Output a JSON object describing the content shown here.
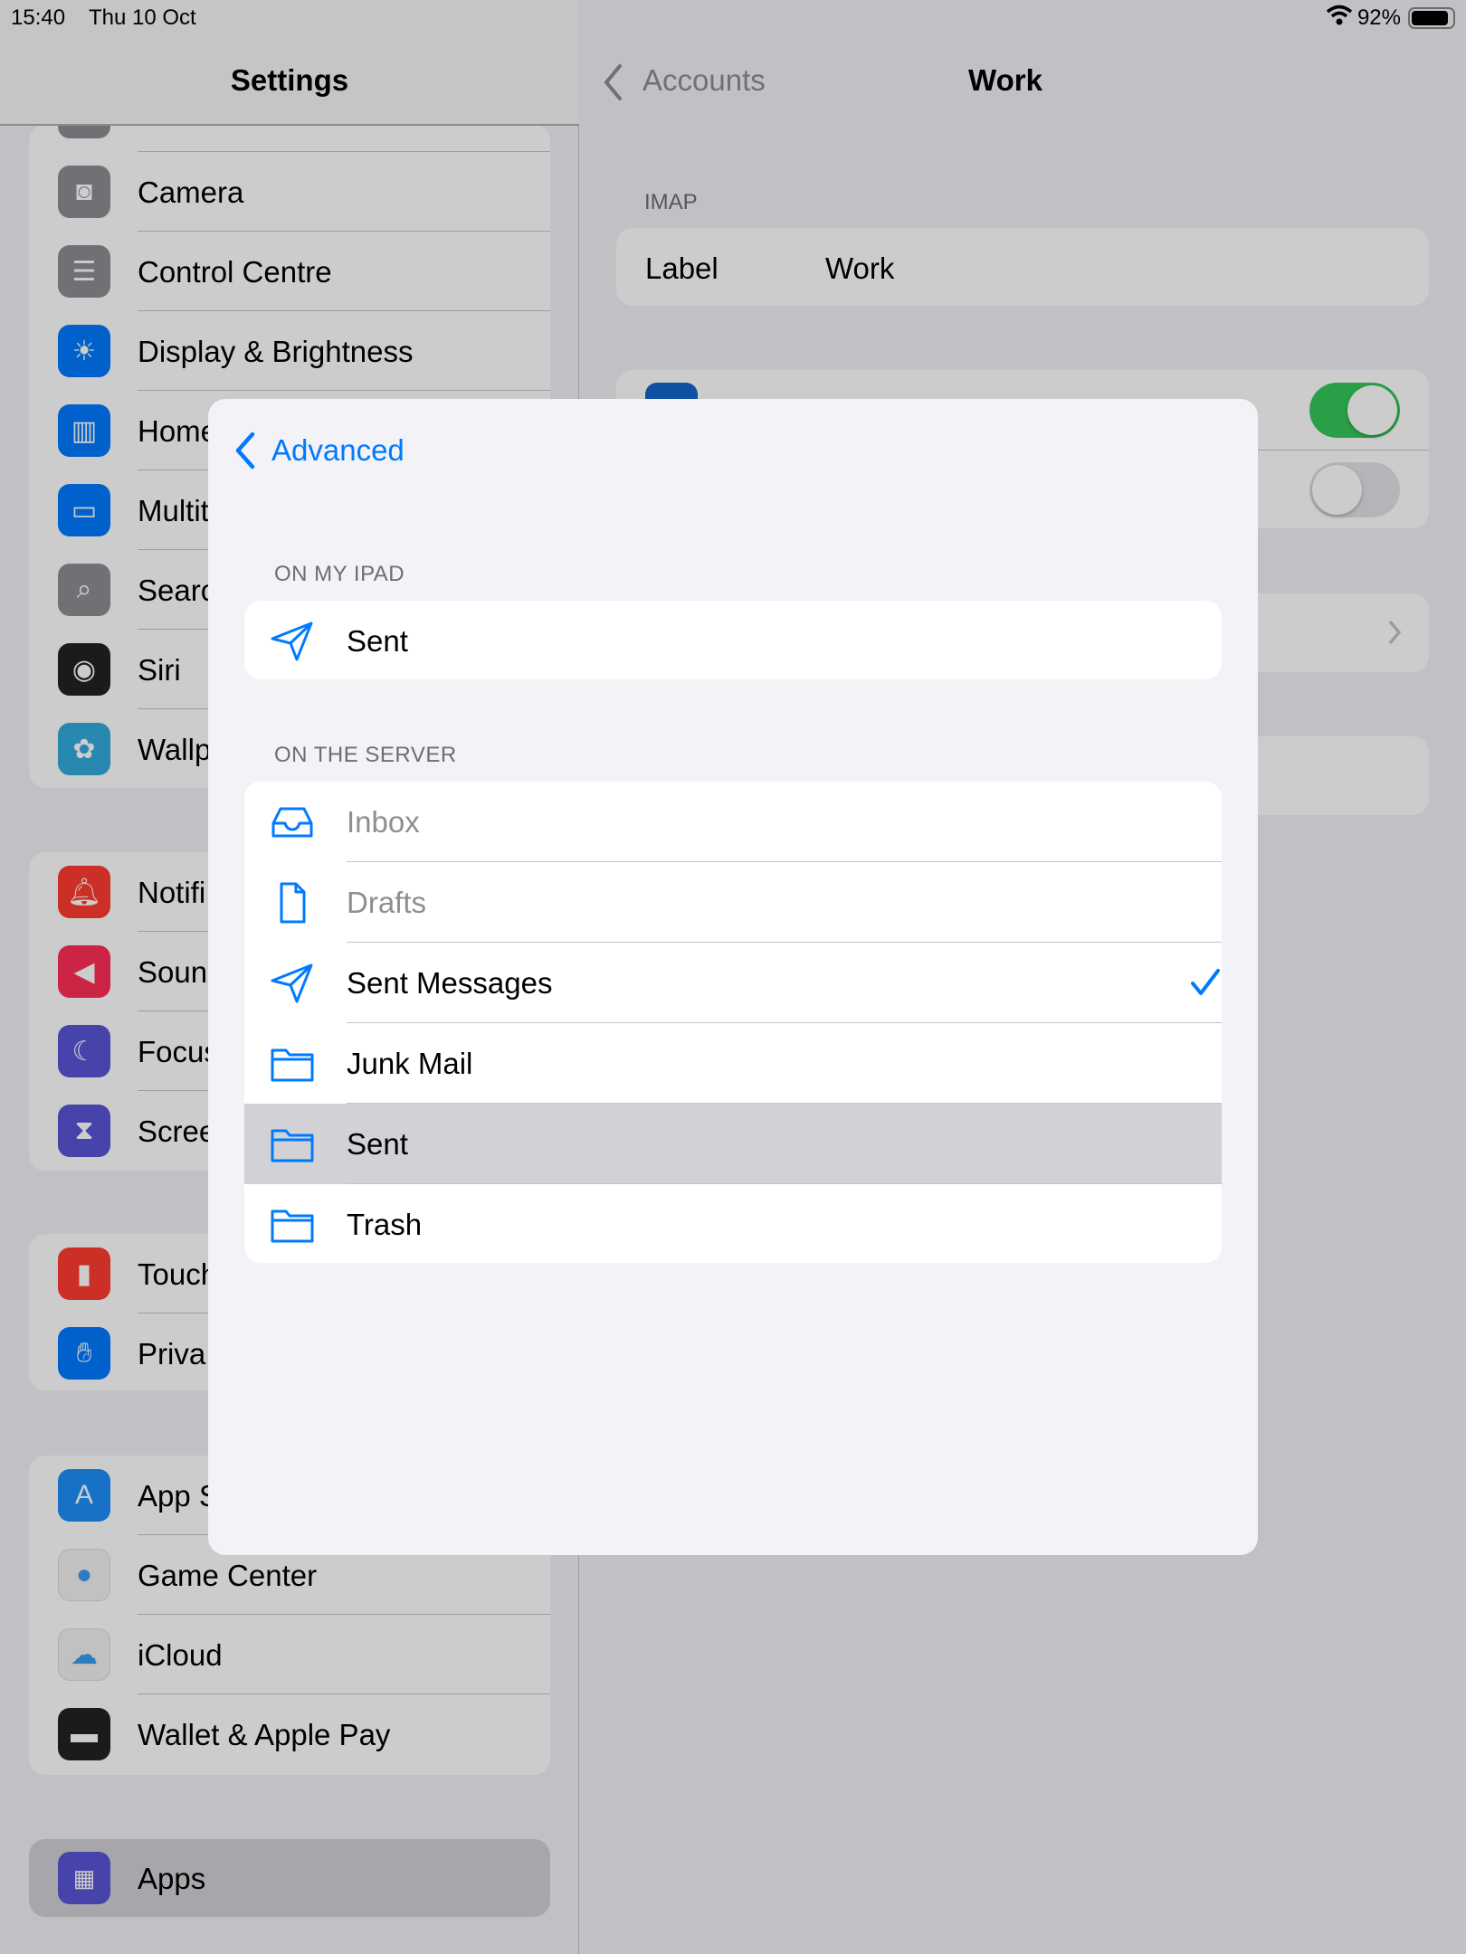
{
  "status": {
    "time": "15:40",
    "date": "Thu 10 Oct",
    "battery": "92%",
    "battery_level": 0.92
  },
  "sidebar": {
    "title": "Settings",
    "groups": [
      [
        {
          "label": "Camera",
          "icon": "camera-icon",
          "color": "#8e8e93"
        },
        {
          "label": "Control Centre",
          "icon": "switches-icon",
          "color": "#8e8e93"
        },
        {
          "label": "Display & Brightness",
          "icon": "sun-icon",
          "color": "#007aff"
        },
        {
          "label": "Home",
          "icon": "home-screen-icon",
          "color": "#007aff"
        },
        {
          "label": "Multit",
          "icon": "multitasking-icon",
          "color": "#007aff"
        },
        {
          "label": "Searc",
          "icon": "search-icon",
          "color": "#8e8e93"
        },
        {
          "label": "Siri",
          "icon": "siri-icon",
          "color": "#222"
        },
        {
          "label": "Wallp",
          "icon": "flower-icon",
          "color": "#34aadc"
        }
      ],
      [
        {
          "label": "Notifi",
          "icon": "bell-icon",
          "color": "#ff3b30"
        },
        {
          "label": "Soun",
          "icon": "speaker-icon",
          "color": "#ff2d55"
        },
        {
          "label": "Focus",
          "icon": "moon-icon",
          "color": "#5856d6"
        },
        {
          "label": "Scree",
          "icon": "hourglass-icon",
          "color": "#5856d6"
        }
      ],
      [
        {
          "label": "Touch",
          "icon": "lock-icon",
          "color": "#ff3b30"
        },
        {
          "label": "Priva",
          "icon": "hand-icon",
          "color": "#007aff"
        }
      ],
      [
        {
          "label": "App S",
          "icon": "app-store-icon",
          "color": "#1c8ef9"
        },
        {
          "label": "Game Center",
          "icon": "game-center-icon",
          "color": "#f2f2f2"
        },
        {
          "label": "iCloud",
          "icon": "cloud-icon",
          "color": "#f2f2f2"
        },
        {
          "label": "Wallet & Apple Pay",
          "icon": "wallet-icon",
          "color": "#222"
        }
      ]
    ],
    "selected": {
      "label": "Apps",
      "icon": "apps-grid-icon",
      "color": "#5856d6"
    }
  },
  "detail": {
    "back": "Accounts",
    "title": "Work",
    "section": "IMAP",
    "label_key": "Label",
    "label_value": "Work",
    "toggle1_on": true,
    "toggle2_on": false,
    "green": "#34c759"
  },
  "modal": {
    "back": "Advanced",
    "accent": "#007aff",
    "section1": "ON MY IPAD",
    "local": [
      {
        "label": "Sent",
        "icon": "paper-plane-icon"
      }
    ],
    "section2": "ON THE SERVER",
    "server": [
      {
        "label": "Inbox",
        "icon": "tray-icon",
        "disabled": true
      },
      {
        "label": "Drafts",
        "icon": "document-icon",
        "disabled": true
      },
      {
        "label": "Sent Messages",
        "icon": "paper-plane-icon",
        "checked": true
      },
      {
        "label": "Junk Mail",
        "icon": "folder-icon"
      },
      {
        "label": "Sent",
        "icon": "folder-icon",
        "highlighted": true
      },
      {
        "label": "Trash",
        "icon": "folder-icon"
      }
    ]
  }
}
